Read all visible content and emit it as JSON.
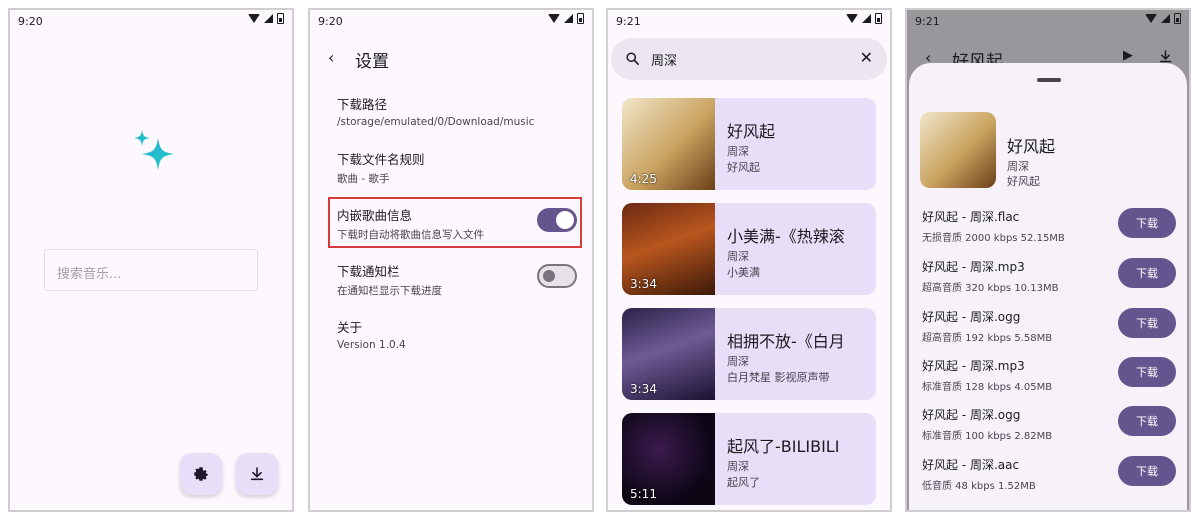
{
  "screens": {
    "home": {
      "time": "9:20",
      "search_placeholder": "搜索音乐..."
    },
    "settings": {
      "time": "9:20",
      "title": "设置",
      "items": [
        {
          "title": "下载路径",
          "subtitle": "/storage/emulated/0/Download/music"
        },
        {
          "title": "下载文件名规则",
          "subtitle": "歌曲 - 歌手"
        },
        {
          "title": "内嵌歌曲信息",
          "subtitle": "下载时自动将歌曲信息写入文件",
          "toggle": true
        },
        {
          "title": "下载通知栏",
          "subtitle": "在通知栏显示下载进度",
          "toggle": false
        },
        {
          "title": "关于",
          "subtitle": "Version 1.0.4"
        }
      ]
    },
    "search": {
      "time": "9:21",
      "query": "周深",
      "results": [
        {
          "title": "好风起",
          "artist": "周深",
          "album": "好风起",
          "duration": "4:25"
        },
        {
          "title": "小美满-《热辣滚",
          "artist": "周深",
          "album": "小美满",
          "duration": "3:34"
        },
        {
          "title": "相拥不放-《白月",
          "artist": "周深",
          "album": "白月梵星 影视原声带",
          "duration": "3:34"
        },
        {
          "title": "起风了-BILIBILI",
          "artist": "周深",
          "album": "起风了",
          "duration": "5:11"
        }
      ]
    },
    "download": {
      "time": "9:21",
      "header_title": "好风起",
      "song": {
        "title": "好风起",
        "artist": "周深",
        "album": "好风起"
      },
      "button_label": "下载",
      "files": [
        {
          "name": "好风起 - 周深.flac",
          "meta": "无损音质  2000 kbps  52.15MB"
        },
        {
          "name": "好风起 - 周深.mp3",
          "meta": "超高音质  320 kbps  10.13MB"
        },
        {
          "name": "好风起 - 周深.ogg",
          "meta": "超高音质  192 kbps  5.58MB"
        },
        {
          "name": "好风起 - 周深.mp3",
          "meta": "标准音质  128 kbps  4.05MB"
        },
        {
          "name": "好风起 - 周深.ogg",
          "meta": "标准音质  100 kbps  2.82MB"
        },
        {
          "name": "好风起 - 周深.aac",
          "meta": "低音质  48 kbps  1.52MB"
        }
      ]
    }
  },
  "colors": {
    "accent": "#65558f",
    "card": "#e8def8",
    "highlight": "#d73b3b"
  }
}
